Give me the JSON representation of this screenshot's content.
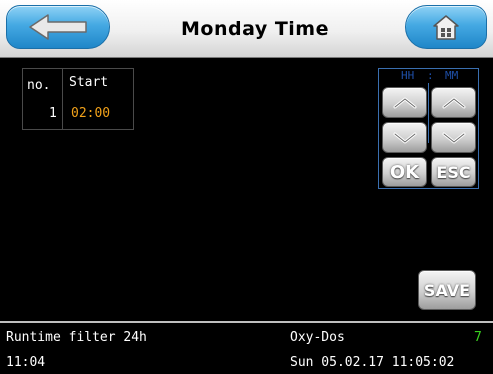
{
  "header": {
    "title": "Monday Time",
    "back_icon": "arrow-left-icon",
    "home_icon": "house-icon",
    "accent_color": "#3aa2e0"
  },
  "schedule": {
    "columns": [
      "no.",
      "Start"
    ],
    "rows": [
      {
        "no": "1",
        "start": "02:00"
      }
    ],
    "start_color": "#f2a21a"
  },
  "time_adjuster": {
    "hh_label": "HH",
    "separator": ":",
    "mm_label": "MM",
    "up_icon": "chevron-up-icon",
    "down_icon": "chevron-down-icon",
    "ok_label": "OK",
    "esc_label": "ESC"
  },
  "save_label": "SAVE",
  "status_bar": {
    "filter_label": "Runtime filter 24h",
    "filter_time": "11:04",
    "dosing_label": "Oxy-Dos",
    "dosing_value": "7",
    "dosing_value_color": "#39d11f",
    "datetime": "Sun 05.02.17 11:05:02"
  }
}
